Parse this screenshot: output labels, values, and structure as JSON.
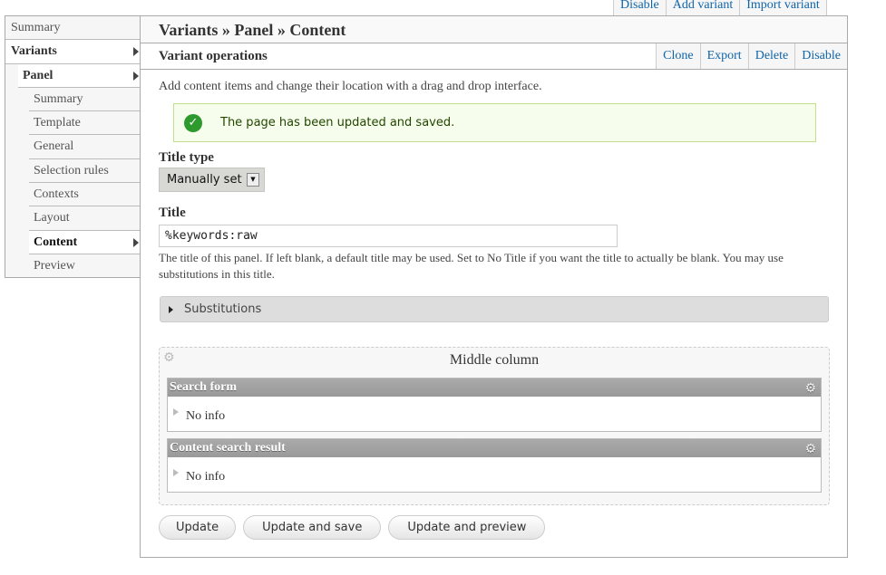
{
  "top_links": [
    "Disable",
    "Add variant",
    "Import variant"
  ],
  "sidebar": {
    "items": [
      {
        "label": "Summary",
        "level": 1
      },
      {
        "label": "Variants",
        "level": 1,
        "expanded": true
      },
      {
        "label": "Panel",
        "level": 2,
        "expanded": true
      },
      {
        "label": "Summary",
        "level": 3
      },
      {
        "label": "Template",
        "level": 3
      },
      {
        "label": "General",
        "level": 3
      },
      {
        "label": "Selection rules",
        "level": 3
      },
      {
        "label": "Contexts",
        "level": 3
      },
      {
        "label": "Layout",
        "level": 3
      },
      {
        "label": "Content",
        "level": 3,
        "active": true
      },
      {
        "label": "Preview",
        "level": 3
      }
    ]
  },
  "header": {
    "title": "Variants » Panel » Content"
  },
  "operations": {
    "label": "Variant operations",
    "links": [
      "Clone",
      "Export",
      "Delete",
      "Disable"
    ]
  },
  "description": "Add content items and change their location with a drag and drop interface.",
  "message": {
    "text": "The page has been updated and saved.",
    "icon": "check-circle-icon",
    "color": "#2e9a2e"
  },
  "form": {
    "title_type_label": "Title type",
    "title_type_value": "Manually set",
    "title_label": "Title",
    "title_value": "%keywords:raw",
    "title_help": "The title of this panel. If left blank, a default title may be used. Set to No Title if you want the title to actually be blank. You may use substitutions in this title.",
    "substitutions": "Substitutions"
  },
  "region": {
    "title": "Middle column",
    "panes": [
      {
        "title": "Search form",
        "body": "No info"
      },
      {
        "title": "Content search result",
        "body": "No info"
      }
    ]
  },
  "buttons": [
    "Update",
    "Update and save",
    "Update and preview"
  ]
}
